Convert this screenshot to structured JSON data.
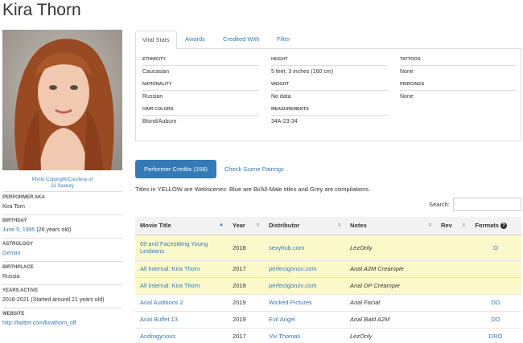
{
  "page": {
    "title": "Kira Thorn"
  },
  "photo": {
    "credit_line1": "Photo Copyright/Courtesy of",
    "credit_line2": "21 Sextury"
  },
  "bio": [
    {
      "label": "PERFORMER AKA",
      "value": "Kira Torn"
    },
    {
      "label": "BIRTHDAY",
      "value_link": "June 9, 1995",
      "value_extra": " (26 years old)"
    },
    {
      "label": "ASTROLOGY",
      "value_link": "Gemini"
    },
    {
      "label": "BIRTHPLACE",
      "value": "Russia"
    },
    {
      "label": "YEARS ACTIVE",
      "value": "2016-2021 (Started around 21 years old)"
    },
    {
      "label": "WEBSITE",
      "value_link": "http://twitter.com/kirathorn_off"
    }
  ],
  "tabs": [
    {
      "label": "Vital Stats",
      "active": true
    },
    {
      "label": "Awards"
    },
    {
      "label": "Credited With"
    },
    {
      "label": "Filter"
    }
  ],
  "stats": {
    "col1": [
      {
        "label": "ETHNICITY",
        "value": "Caucasian"
      },
      {
        "label": "NATIONALITY",
        "value": "Russian"
      },
      {
        "label": "HAIR COLORS",
        "value": "Blond/Auburn"
      }
    ],
    "col2": [
      {
        "label": "HEIGHT",
        "value": "5 feet, 3 inches (160 cm)"
      },
      {
        "label": "WEIGHT",
        "value": "No data"
      },
      {
        "label": "MEASUREMENTS",
        "value": "34A-23-34"
      }
    ],
    "col3": [
      {
        "label": "TATTOOS",
        "value": "None"
      },
      {
        "label": "PIERCINGS",
        "value": "None"
      }
    ]
  },
  "buttons": {
    "performer_credits": "Performer Credits (158)",
    "scene_pairings": "Check Scene Pairings"
  },
  "legend": "Titles in YELLOW are Webscenes: Blue are Bi/All-Male titles and Grey are compilations.",
  "search": {
    "label": "Search:",
    "placeholder": ""
  },
  "table": {
    "headers": [
      "Movie Title",
      "Year",
      "Distributor",
      "Notes",
      "Rev",
      "Formats"
    ],
    "rows": [
      {
        "title": "69 and Facesitting Young Lesbians",
        "year": "2018",
        "distributor": "sexyhub.com",
        "notes": "LezOnly",
        "rev": "",
        "formats": "O",
        "yellow": true
      },
      {
        "title": "All Internal: Kira Thorn",
        "year": "2017",
        "distributor": "perfectgonzo.com",
        "notes": "Anal A2M Creampie",
        "rev": "",
        "formats": "",
        "yellow": true
      },
      {
        "title": "All Internal: Kira Thorn",
        "year": "2019",
        "distributor": "perfectgonzo.com",
        "notes": "Anal DP Creampie",
        "rev": "",
        "formats": "",
        "yellow": true
      },
      {
        "title": "Anal Auditions 2",
        "year": "2019",
        "distributor": "Wicked Pictures",
        "notes": "Anal Facial",
        "rev": "",
        "formats": "DO",
        "yellow": false
      },
      {
        "title": "Anal Buffet 13",
        "year": "2019",
        "distributor": "Evil Angel",
        "notes": "Anal Bald A2M",
        "rev": "",
        "formats": "DO",
        "yellow": false
      },
      {
        "title": "Androgynous",
        "year": "2017",
        "distributor": "Viv Thomas",
        "notes": "LezOnly",
        "rev": "",
        "formats": "DRO",
        "yellow": false
      }
    ]
  },
  "colors": {
    "link": "#337ab7",
    "webscene_row": "#fbf9c9",
    "primary_button": "#337ab7"
  }
}
